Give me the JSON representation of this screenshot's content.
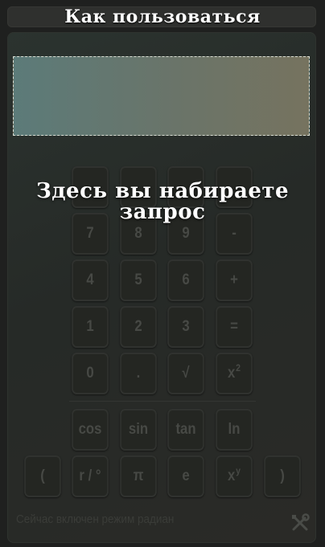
{
  "header": {
    "title": "Как пользоваться"
  },
  "overlay": {
    "hint": "Здесь вы набираете запрос"
  },
  "display": {
    "value": ""
  },
  "keypad": {
    "keys": [
      {
        "label": "",
        "name": "key-hidden-1"
      },
      {
        "label": "",
        "name": "key-hidden-2"
      },
      {
        "label": "",
        "name": "key-hidden-3"
      },
      {
        "label": "",
        "name": "key-hidden-4"
      },
      {
        "label": "7",
        "name": "key-7"
      },
      {
        "label": "8",
        "name": "key-8"
      },
      {
        "label": "9",
        "name": "key-9"
      },
      {
        "label": "-",
        "name": "key-minus"
      },
      {
        "label": "4",
        "name": "key-4"
      },
      {
        "label": "5",
        "name": "key-5"
      },
      {
        "label": "6",
        "name": "key-6"
      },
      {
        "label": "+",
        "name": "key-plus"
      },
      {
        "label": "1",
        "name": "key-1"
      },
      {
        "label": "2",
        "name": "key-2"
      },
      {
        "label": "3",
        "name": "key-3"
      },
      {
        "label": "=",
        "name": "key-equals"
      },
      {
        "label": "0",
        "name": "key-0"
      },
      {
        "label": ".",
        "name": "key-decimal"
      },
      {
        "label": "√",
        "name": "key-sqrt"
      },
      {
        "label": "x",
        "sup": "2",
        "name": "key-square"
      },
      {
        "label": "cos",
        "name": "key-cos"
      },
      {
        "label": "sin",
        "name": "key-sin"
      },
      {
        "label": "tan",
        "name": "key-tan"
      },
      {
        "label": "ln",
        "name": "key-ln"
      },
      {
        "label": "(",
        "name": "key-open-paren"
      },
      {
        "label": "r / °",
        "name": "key-rad-deg"
      },
      {
        "label": "π",
        "name": "key-pi"
      },
      {
        "label": "e",
        "name": "key-e"
      },
      {
        "label": "x",
        "sup": "y",
        "name": "key-power"
      },
      {
        "label": ")",
        "name": "key-close-paren"
      }
    ]
  },
  "footer": {
    "mode_text": "Сейчас включен режим радиан",
    "tools_icon": "tools-icon"
  },
  "colors": {
    "background": "#1f201f",
    "panel": "#282c29",
    "key": "#242622",
    "key_text": "#474945",
    "display_left": "#5c7b79",
    "display_right": "#76735f",
    "overlay_text": "#ffffff"
  }
}
